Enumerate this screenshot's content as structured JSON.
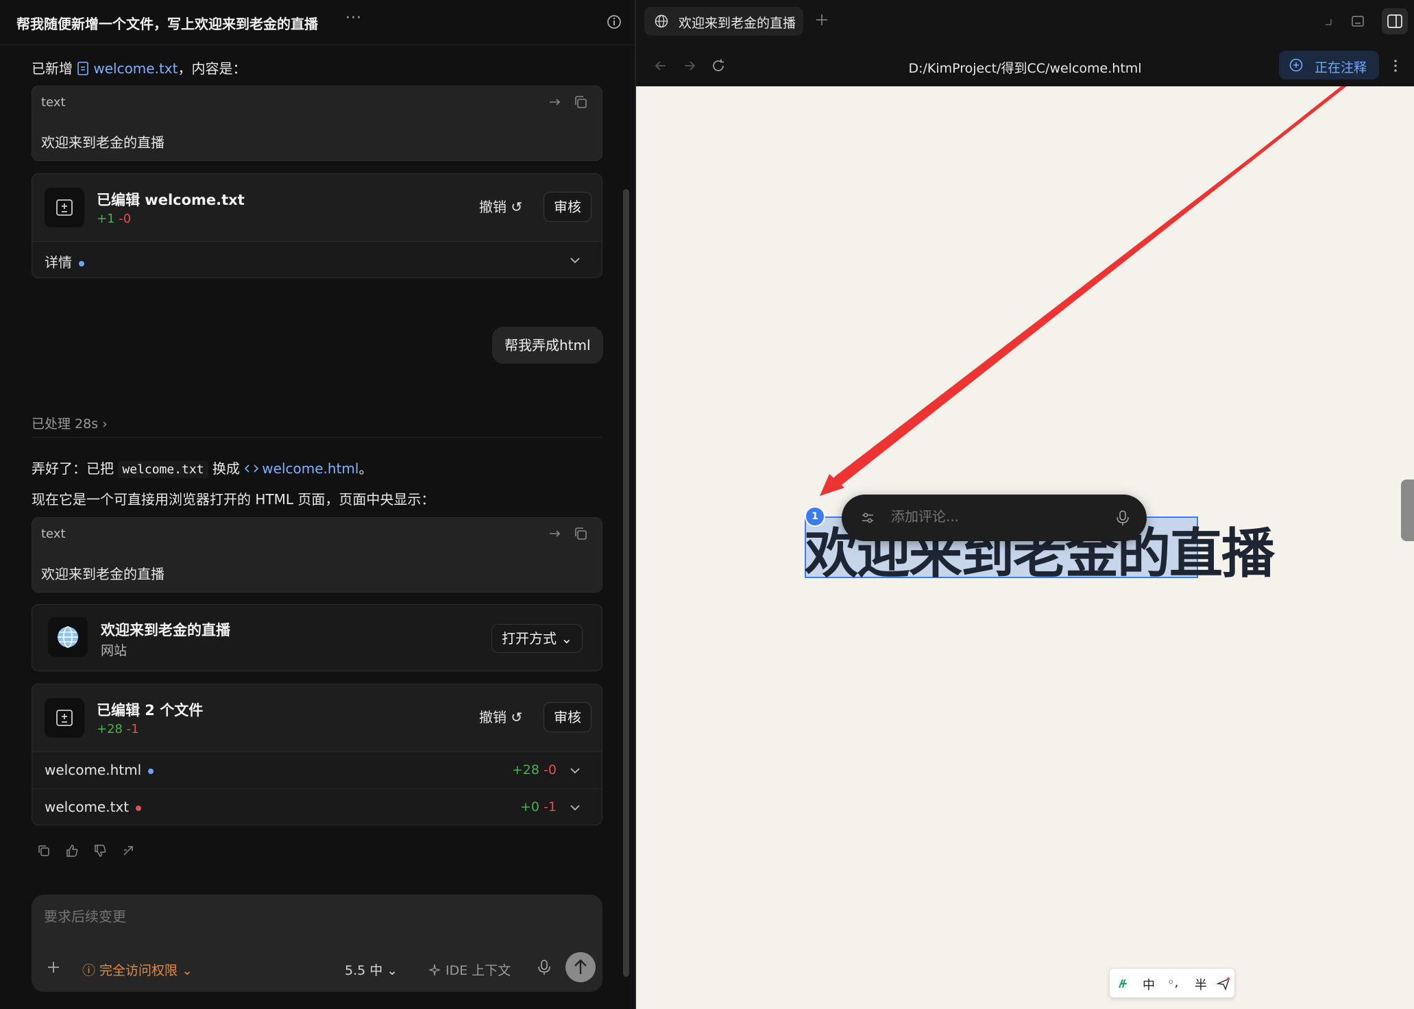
{
  "left": {
    "title": "帮我随便新增一个文件，写上欢迎来到老金的直播",
    "more": "···",
    "msg1": {
      "prefix": "已新增 ",
      "file": "welcome.txt",
      "suffix": "，内容是："
    },
    "codebox1": {
      "lang": "text",
      "content": "欢迎来到老金的直播"
    },
    "edit1": {
      "title": "已编辑 welcome.txt",
      "plus": "+1",
      "minus": "-0",
      "undo": "撤销 ↺",
      "review": "审核",
      "detail": "详情"
    },
    "user_msg": "帮我弄成html",
    "processed": "已处理 28s  ›",
    "msg2": {
      "prefix": "弄好了：已把 ",
      "code": "welcome.txt",
      "mid": " 换成 ",
      "file": "welcome.html",
      "suffix": "。"
    },
    "msg3": "现在它是一个可直接用浏览器打开的 HTML 页面，页面中央显示：",
    "codebox2": {
      "lang": "text",
      "content": "欢迎来到老金的直播"
    },
    "site": {
      "title": "欢迎来到老金的直播",
      "sub": "网站",
      "open": "打开方式 ⌄"
    },
    "edit2": {
      "title": "已编辑 2 个文件",
      "plus": "+28",
      "minus": "-1",
      "undo": "撤销 ↺",
      "review": "审核",
      "files": [
        {
          "name": "welcome.html",
          "plus": "+28",
          "minus": "-0",
          "dot_color": "#6fa0ff"
        },
        {
          "name": "welcome.txt",
          "plus": "+0",
          "minus": "-1",
          "dot_color": "#e0524d"
        }
      ]
    },
    "composer": {
      "placeholder": "要求后续变更",
      "access": "ⓘ 完全访问权限 ⌄",
      "model": "5.5 中 ⌄",
      "ide": "IDE 上下文"
    }
  },
  "right": {
    "tab_title": "欢迎来到老金的直播",
    "url": "D:/KimProject/得到CC/welcome.html",
    "annotating": "正在注释",
    "headline": "欢迎来到老金的直播",
    "badge": "1",
    "comment_placeholder": "添加评论...",
    "ime": {
      "k1": "中",
      "k2": "◦,",
      "k3": "半"
    }
  },
  "colors": {
    "accent": "#3b7cf5",
    "link": "#7fb1ff",
    "plus": "#4caf50",
    "minus": "#e0524d",
    "warning": "#e88a3c",
    "arrow": "#ee3333"
  }
}
